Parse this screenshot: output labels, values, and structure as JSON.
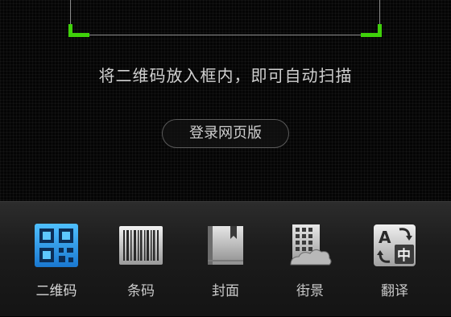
{
  "scanner": {
    "hint": "将二维码放入框内，即可自动扫描",
    "web_login_label": "登录网页版",
    "frame_color": "#3fd10a"
  },
  "toolbar": {
    "items": [
      {
        "label": "二维码",
        "icon": "qr-code-icon",
        "active": true
      },
      {
        "label": "条码",
        "icon": "barcode-icon",
        "active": false
      },
      {
        "label": "封面",
        "icon": "book-cover-icon",
        "active": false
      },
      {
        "label": "街景",
        "icon": "street-view-icon",
        "active": false
      },
      {
        "label": "翻译",
        "icon": "translate-icon",
        "active": false
      }
    ],
    "active_color": "#2a9be8"
  }
}
